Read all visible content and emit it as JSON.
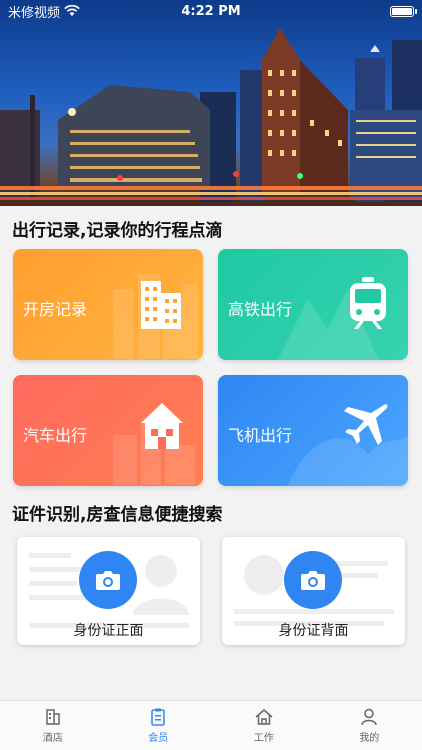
{
  "status_bar": {
    "carrier": "米修视频",
    "time": "4:22 PM"
  },
  "hero": {
    "image": "city-night-skyline"
  },
  "travel_section": {
    "title": "出行记录,记录你的行程点滴",
    "cards": [
      {
        "label": "开房记录",
        "icon": "building-icon",
        "color": "#ffa431"
      },
      {
        "label": "高铁出行",
        "icon": "train-icon",
        "color": "#22cba6"
      },
      {
        "label": "汽车出行",
        "icon": "house-icon",
        "color": "#ff6c5a"
      },
      {
        "label": "飞机出行",
        "icon": "airplane-icon",
        "color": "#3591f5"
      }
    ]
  },
  "id_section": {
    "title": "证件识别,房查信息便捷搜索",
    "cards": [
      {
        "label": "身份证正面",
        "icon": "camera-icon"
      },
      {
        "label": "身份证背面",
        "icon": "camera-icon"
      }
    ]
  },
  "tabbar": {
    "tabs": [
      {
        "label": "酒店",
        "icon": "hotel-icon",
        "active": false
      },
      {
        "label": "会员",
        "icon": "member-icon",
        "active": true
      },
      {
        "label": "工作",
        "icon": "home-icon",
        "active": false
      },
      {
        "label": "我的",
        "icon": "profile-icon",
        "active": false
      }
    ],
    "active_color": "#2f86f2"
  }
}
